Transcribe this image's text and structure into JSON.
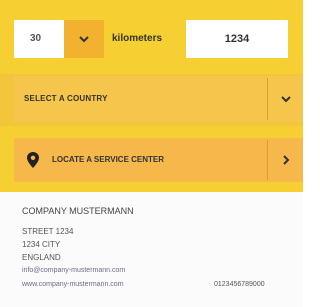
{
  "filter": {
    "radius_value": "30",
    "unit_label": "kilometers",
    "distance_value": "1234"
  },
  "country": {
    "label": "SELECT A COUNTRY"
  },
  "locate": {
    "label": "LOCATE A SERVICE CENTER"
  },
  "address": {
    "company": "COMPANY MUSTERMANN",
    "street": "STREET 1234",
    "city": "1234 CITY",
    "country": "ENGLAND",
    "email": "info@company-mustermann.com",
    "website": "www.company-mustermann.com",
    "phone": "0123456789000"
  },
  "colors": {
    "accent_yellow": "#f6cf33",
    "chevron_orange": "#f2b12f"
  },
  "icons": {
    "radius_dropdown": "chevron-down-icon",
    "country_dropdown": "chevron-down-icon",
    "locate_pin": "map-pin-icon",
    "locate_go": "chevron-right-icon"
  }
}
